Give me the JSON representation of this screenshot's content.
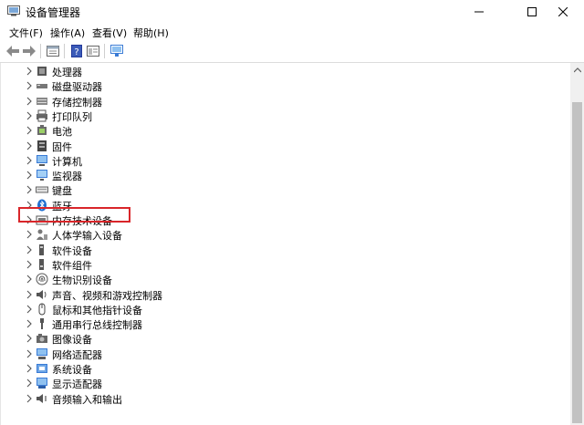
{
  "window": {
    "title": "设备管理器",
    "minimize": "—",
    "maximize": "☐",
    "close": "✕"
  },
  "menu": [
    "文件(F)",
    "操作(A)",
    "查看(V)",
    "帮助(H)"
  ],
  "toolbar_icons": [
    "back-icon",
    "forward-icon",
    "properties-icon",
    "help-icon",
    "details-icon",
    "monitor-icon"
  ],
  "tree": [
    {
      "label": "处理器",
      "icon": "processor-icon"
    },
    {
      "label": "磁盘驱动器",
      "icon": "disk-drive-icon"
    },
    {
      "label": "存储控制器",
      "icon": "storage-controller-icon"
    },
    {
      "label": "打印队列",
      "icon": "printer-icon"
    },
    {
      "label": "电池",
      "icon": "battery-icon"
    },
    {
      "label": "固件",
      "icon": "firmware-icon"
    },
    {
      "label": "计算机",
      "icon": "computer-icon"
    },
    {
      "label": "监视器",
      "icon": "monitor-icon"
    },
    {
      "label": "键盘",
      "icon": "keyboard-icon"
    },
    {
      "label": "蓝牙",
      "icon": "bluetooth-icon"
    },
    {
      "label": "内存技术设备",
      "icon": "memory-icon"
    },
    {
      "label": "人体学输入设备",
      "icon": "hid-icon"
    },
    {
      "label": "软件设备",
      "icon": "software-device-icon"
    },
    {
      "label": "软件组件",
      "icon": "software-component-icon"
    },
    {
      "label": "生物识别设备",
      "icon": "fingerprint-icon",
      "highlighted": true
    },
    {
      "label": "声音、视频和游戏控制器",
      "icon": "speaker-icon"
    },
    {
      "label": "鼠标和其他指针设备",
      "icon": "mouse-icon"
    },
    {
      "label": "通用串行总线控制器",
      "icon": "usb-icon"
    },
    {
      "label": "图像设备",
      "icon": "camera-icon"
    },
    {
      "label": "网络适配器",
      "icon": "network-icon"
    },
    {
      "label": "系统设备",
      "icon": "system-device-icon"
    },
    {
      "label": "显示适配器",
      "icon": "display-adapter-icon"
    },
    {
      "label": "音频输入和输出",
      "icon": "audio-io-icon"
    }
  ],
  "colors": {
    "highlight_border": "#d9262a",
    "scroll_thumb": "#c2c2c2",
    "icon_blue": "#3a7bd5"
  }
}
